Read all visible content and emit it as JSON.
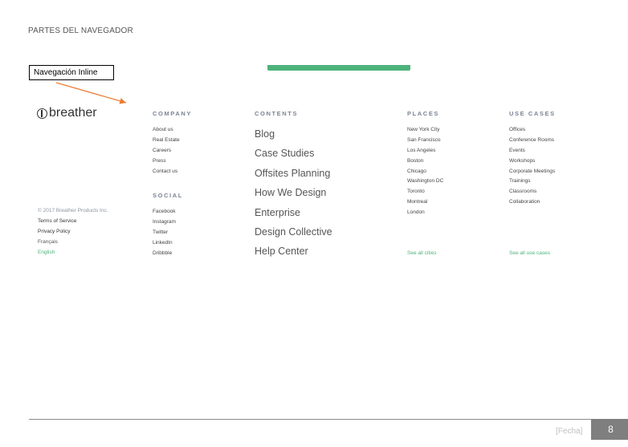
{
  "header": {
    "title": "PARTES DEL NAVEGADOR"
  },
  "callout": {
    "label": "Navegación Inline"
  },
  "colors": {
    "accent_green": "#4db37b",
    "arrow_orange": "#ed7d31",
    "footer_box": "#7f7f7f"
  },
  "footer_nav": {
    "logo": {
      "text": "breather",
      "icon": "tree-icon"
    },
    "company": {
      "heading": "COMPANY",
      "links": [
        "About us",
        "Real Estate",
        "Careers",
        "Press",
        "Contact us"
      ]
    },
    "social": {
      "heading": "SOCIAL",
      "links": [
        "Facebook",
        "Instagram",
        "Twitter",
        "LinkedIn",
        "Dribbble"
      ]
    },
    "contents": {
      "heading": "CONTENTS",
      "links": [
        "Blog",
        "Case Studies",
        "Offsites Planning",
        "How We Design",
        "Enterprise",
        "Design Collective",
        "Help Center"
      ]
    },
    "places": {
      "heading": "PLACES",
      "links": [
        "New York City",
        "San Francisco",
        "Los Angeles",
        "Boston",
        "Chicago",
        "Washington DC",
        "Toronto",
        "Montreal",
        "London"
      ],
      "see_all": "See all cities"
    },
    "use_cases": {
      "heading": "USE CASES",
      "links": [
        "Offices",
        "Conference Rooms",
        "Events",
        "Workshops",
        "Corporate Meetings",
        "Trainings",
        "Classrooms",
        "Collaboration"
      ],
      "see_all": "See all use cases"
    },
    "legal": {
      "copyright": "© 2017 Breather Products Inc.",
      "terms": "Terms of Service",
      "privacy": "Privacy Policy",
      "lang_fr": "Français",
      "lang_en": "English"
    }
  },
  "footer": {
    "date": "[Fecha]",
    "page_number": "8"
  }
}
